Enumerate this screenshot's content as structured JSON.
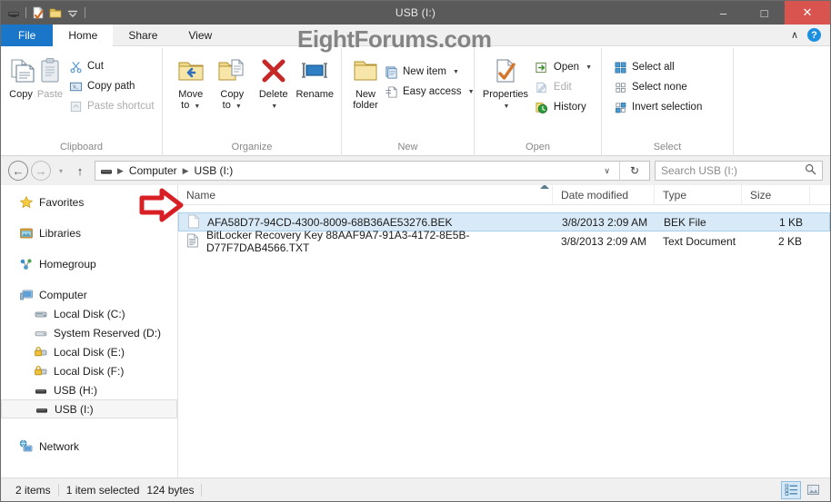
{
  "window": {
    "title": "USB (I:)",
    "watermark": "EightForums.com",
    "controls": {
      "minimize": "–",
      "maximize": "□",
      "close": "✕"
    },
    "quick_access": [
      "usb-drive-icon",
      "properties-icon",
      "new-folder-icon",
      "customize-chevron-icon"
    ]
  },
  "tabs": [
    {
      "label": "File",
      "id": "file"
    },
    {
      "label": "Home",
      "id": "home"
    },
    {
      "label": "Share",
      "id": "share"
    },
    {
      "label": "View",
      "id": "view"
    }
  ],
  "tab_right": {
    "collapse": "∧",
    "help": "?"
  },
  "ribbon": {
    "groups": [
      {
        "label": "Clipboard",
        "big": [
          {
            "label": "Copy",
            "icon": "copy-icon",
            "disabled": false
          },
          {
            "label": "Paste",
            "icon": "paste-icon",
            "disabled": true
          }
        ],
        "small": [
          {
            "label": "Cut",
            "icon": "scissors-icon",
            "disabled": false
          },
          {
            "label": "Copy path",
            "icon": "copy-path-icon",
            "disabled": false
          },
          {
            "label": "Paste shortcut",
            "icon": "paste-shortcut-icon",
            "disabled": true
          }
        ]
      },
      {
        "label": "Organize",
        "big": [
          {
            "label": "Move\nto",
            "icon": "move-to-icon",
            "dropdown": true
          },
          {
            "label": "Copy\nto",
            "icon": "copy-to-icon",
            "dropdown": true
          },
          {
            "label": "Delete",
            "icon": "delete-icon",
            "dropdown": true
          },
          {
            "label": "Rename",
            "icon": "rename-icon",
            "dropdown": false
          }
        ]
      },
      {
        "label": "New",
        "big": [
          {
            "label": "New\nfolder",
            "icon": "new-folder-icon"
          }
        ],
        "small": [
          {
            "label": "New item",
            "icon": "new-item-icon",
            "dropdown": true
          },
          {
            "label": "Easy access",
            "icon": "easy-access-icon",
            "dropdown": true
          }
        ]
      },
      {
        "label": "Open",
        "big": [
          {
            "label": "Properties",
            "icon": "properties-icon",
            "dropdown": true
          }
        ],
        "small": [
          {
            "label": "Open",
            "icon": "open-icon",
            "dropdown": true
          },
          {
            "label": "Edit",
            "icon": "edit-icon",
            "disabled": true
          },
          {
            "label": "History",
            "icon": "history-icon"
          }
        ]
      },
      {
        "label": "Select",
        "small": [
          {
            "label": "Select all",
            "icon": "select-all-icon"
          },
          {
            "label": "Select none",
            "icon": "select-none-icon"
          },
          {
            "label": "Invert selection",
            "icon": "invert-selection-icon"
          }
        ]
      }
    ]
  },
  "addressbar": {
    "back": "←",
    "forward": "→",
    "recent": "▾",
    "up": "↑",
    "crumb_icon": "usb-drive-icon",
    "crumbs": [
      "Computer",
      "USB (I:)"
    ],
    "dropdown": "∨",
    "refresh": "↻"
  },
  "search": {
    "placeholder": "Search USB (I:)",
    "value": "",
    "icon": "search-icon"
  },
  "navpane": {
    "groups": [
      {
        "label": "Favorites",
        "icon": "star-icon",
        "level": 0
      },
      {
        "label": "Libraries",
        "icon": "libraries-icon",
        "level": 0
      },
      {
        "label": "Homegroup",
        "icon": "homegroup-icon",
        "level": 0
      },
      {
        "label": "Computer",
        "icon": "computer-icon",
        "level": 0
      },
      {
        "label": "Local Disk (C:)",
        "icon": "hard-drive-icon",
        "level": 1
      },
      {
        "label": "System Reserved (D:)",
        "icon": "drive-icon",
        "level": 1
      },
      {
        "label": "Local Disk (E:)",
        "icon": "bitlocker-drive-icon",
        "level": 1
      },
      {
        "label": "Local Disk (F:)",
        "icon": "bitlocker-drive-icon",
        "level": 1
      },
      {
        "label": "USB (H:)",
        "icon": "usb-drive-icon",
        "level": 1
      },
      {
        "label": "USB (I:)",
        "icon": "usb-drive-icon",
        "level": 1,
        "selected": true
      },
      {
        "label": "Network",
        "icon": "network-icon",
        "level": 0
      }
    ]
  },
  "filelist": {
    "columns": [
      "Name",
      "Date modified",
      "Type",
      "Size"
    ],
    "sorted_by": "Name",
    "sort_direction": "ascending",
    "rows": [
      {
        "name": "AFA58D77-94CD-4300-8009-68B36AE53276.BEK",
        "date": "3/8/2013 2:09 AM",
        "type": "BEK File",
        "size": "1 KB",
        "icon": "blank-file-icon",
        "selected": true
      },
      {
        "name": "BitLocker Recovery Key 88AAF9A7-91A3-4172-8E5B-D77F7DAB4566.TXT",
        "date": "3/8/2013 2:09 AM",
        "type": "Text Document",
        "size": "2 KB",
        "icon": "text-document-icon",
        "selected": false
      }
    ]
  },
  "annotation": {
    "type": "red-arrow",
    "points_to": "first-file-row"
  },
  "statusbar": {
    "item_count": "2 items",
    "selection": "1 item selected",
    "selection_size": "124 bytes",
    "views": [
      {
        "name": "details-view",
        "active": true
      },
      {
        "name": "large-icons-view",
        "active": false
      }
    ]
  },
  "colors": {
    "titlebar": "#5a5a5a",
    "file_tab": "#1976c9",
    "close_button": "#d9534f",
    "selection": "#d8e9f7",
    "selection_border": "#a8d0ec",
    "annotation_red": "#d81f26"
  }
}
